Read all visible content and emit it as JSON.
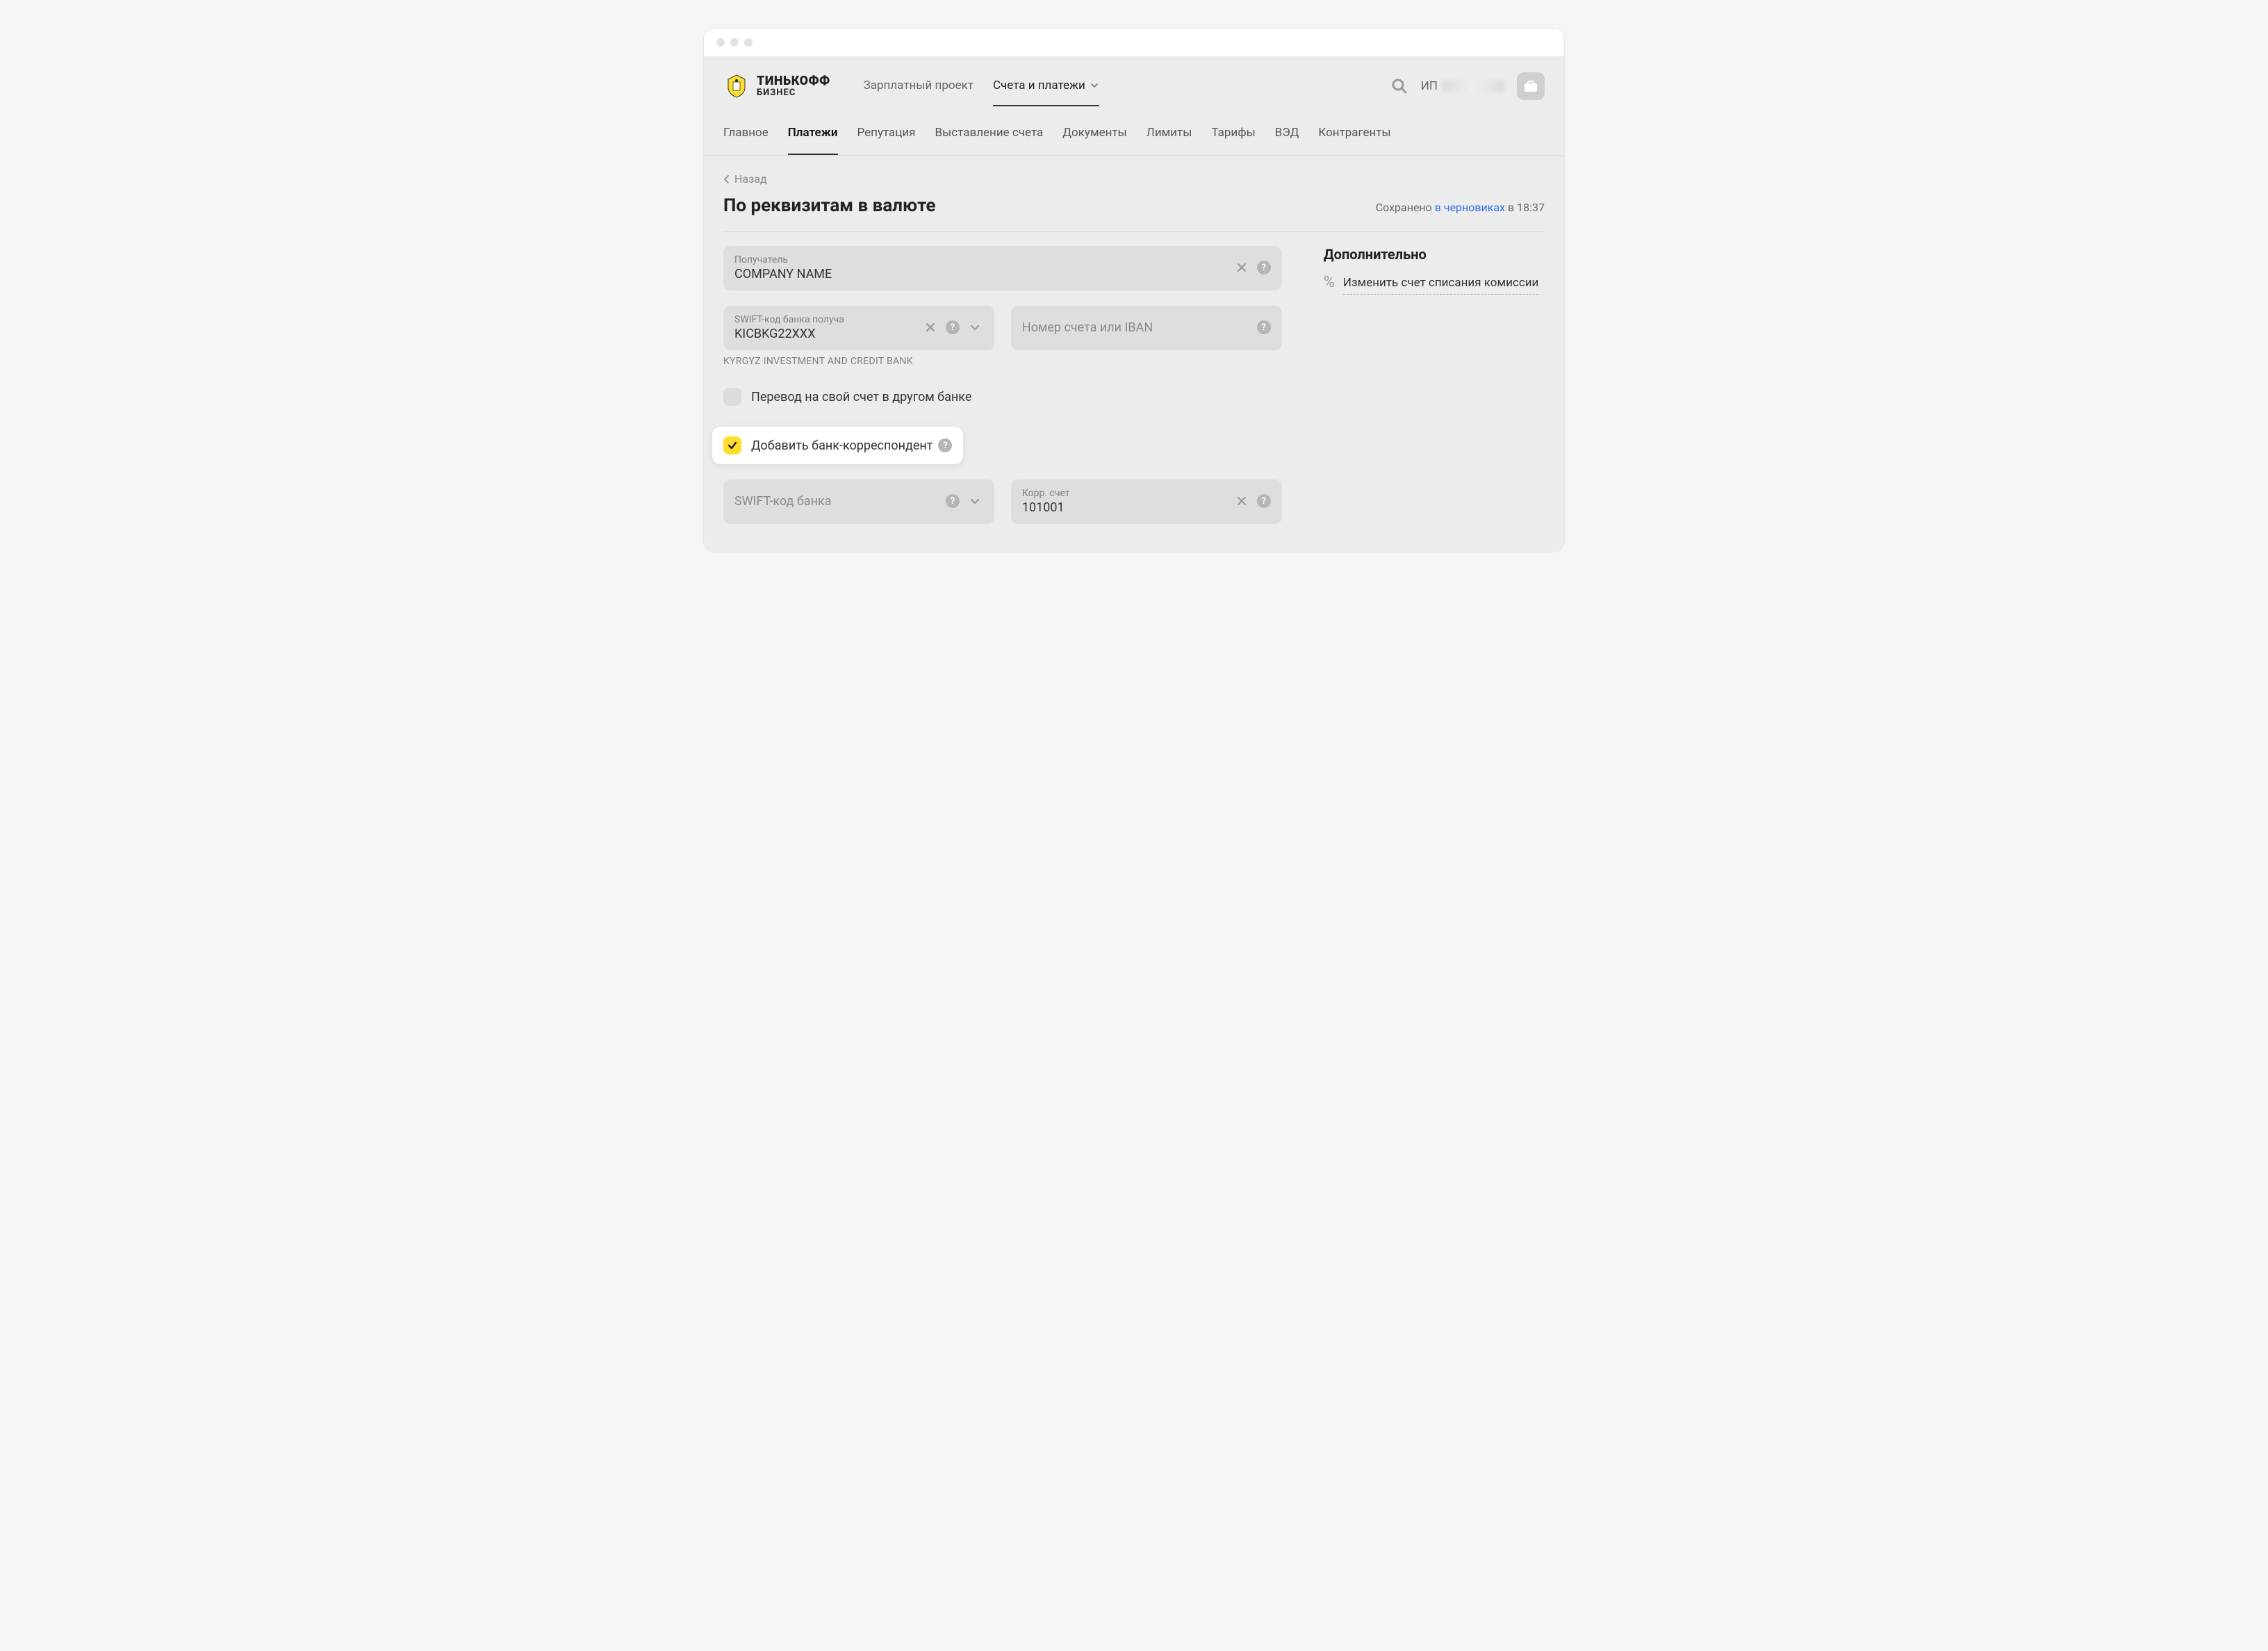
{
  "logo": {
    "line1": "ТИНЬКОФФ",
    "line2": "БИЗНЕС"
  },
  "topNav": {
    "item0": "Зарплатный проект",
    "item1": "Счета и платежи"
  },
  "user": {
    "prefix": "ИП"
  },
  "subNav": {
    "item0": "Главное",
    "item1": "Платежи",
    "item2": "Репутация",
    "item3": "Выставление счета",
    "item4": "Документы",
    "item5": "Лимиты",
    "item6": "Тарифы",
    "item7": "ВЭД",
    "item8": "Контрагенты"
  },
  "back": "Назад",
  "title": "По реквизитам в валюте",
  "saved": {
    "prefix": "Сохранено ",
    "link": "в черновиках",
    "suffix": " в 18:37"
  },
  "form": {
    "recipient": {
      "label": "Получатель",
      "value": "COMPANY NAME"
    },
    "swift": {
      "label": "SWIFT-код банка получа",
      "value": "KICBKG22XXX",
      "bankName": "KYRGYZ INVESTMENT AND CREDIT BANK"
    },
    "iban": {
      "placeholder": "Номер счета или IBAN"
    },
    "ownAccount": {
      "label": "Перевод на свой счет в другом банке"
    },
    "addCorr": {
      "label": "Добавить банк-корреспондент"
    },
    "corrSwift": {
      "placeholder": "SWIFT-код банка"
    },
    "corrAcc": {
      "label": "Корр. счет",
      "value": "101001"
    }
  },
  "side": {
    "title": "Дополнительно",
    "link": "Изменить счет списания комиссии"
  }
}
